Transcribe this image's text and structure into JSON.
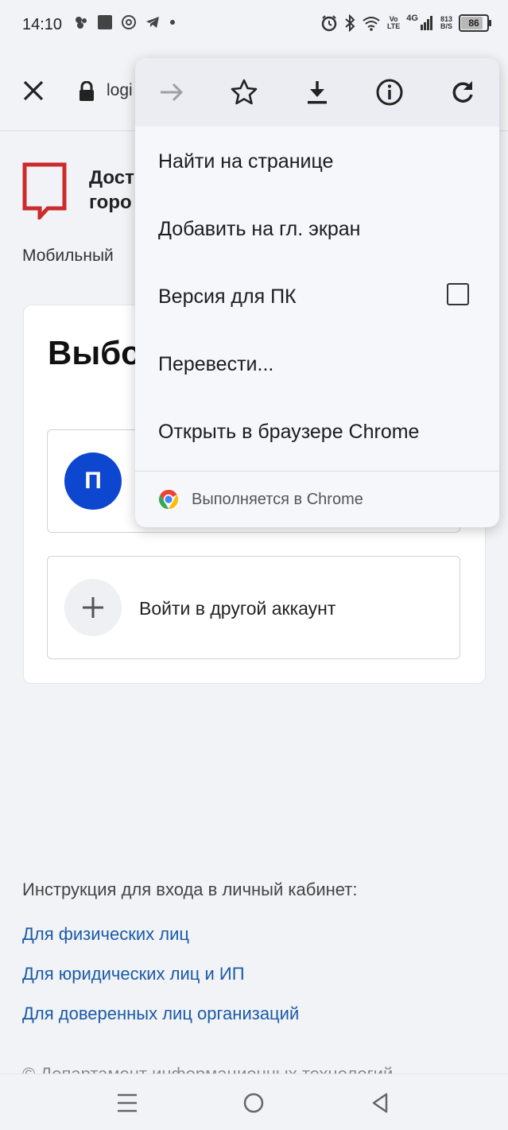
{
  "status_bar": {
    "time": "14:10",
    "network": {
      "volte_top": "Vo",
      "volte_bottom": "LTE",
      "gen": "4G"
    },
    "speed": {
      "value": "813",
      "unit": "B/S"
    },
    "battery": 86
  },
  "toolbar": {
    "url": "logi"
  },
  "page": {
    "title_line1": "Дост",
    "title_line2": "горо",
    "subtitle": "Мобильный",
    "card_heading": "Выбо",
    "account_initial": "П",
    "other_account_label": "Войти в другой аккаунт",
    "instructions_label": "Инструкция для входа в личный кабинет:",
    "links": [
      "Для физических лиц",
      "Для юридических лиц и ИП",
      "Для доверенных лиц организаций"
    ],
    "copyright": "© Департамент информационных технологий"
  },
  "menu": {
    "icons": [
      "forward-icon",
      "star-icon",
      "download-icon",
      "info-icon",
      "refresh-icon"
    ],
    "items": {
      "find": "Найти на странице",
      "add_home": "Добавить на гл. экран",
      "desktop": "Версия для ПК",
      "translate": "Перевести...",
      "open_chrome": "Открыть в браузере Chrome"
    },
    "footer": "Выполняется в Chrome"
  },
  "colors": {
    "accent_blue": "#0d47cf",
    "link": "#1b5aa8",
    "logo_red": "#cc2b2b"
  }
}
